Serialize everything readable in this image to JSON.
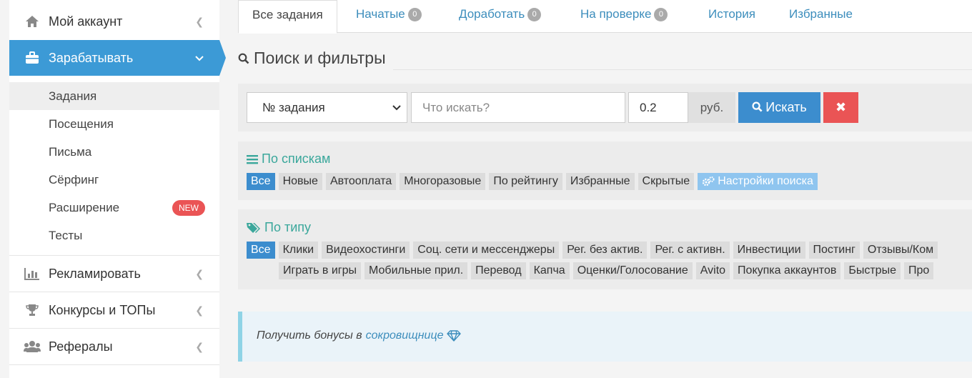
{
  "sidebar": {
    "account": {
      "label": "Мой аккаунт",
      "icon": "home-icon"
    },
    "earn": {
      "label": "Зарабатывать",
      "icon": "briefcase-icon"
    },
    "sub_items": [
      "Задания",
      "Посещения",
      "Письма",
      "Сёрфинг",
      "Расширение",
      "Тесты"
    ],
    "badge_new": "NEW",
    "advertise": {
      "label": "Рекламировать",
      "icon": "bar-chart-icon"
    },
    "contests": {
      "label": "Конкурсы и ТОПы",
      "icon": "trophy-icon"
    },
    "referrals": {
      "label": "Рефералы",
      "icon": "users-icon"
    }
  },
  "tabs": [
    {
      "label": "Все задания"
    },
    {
      "label": "Начатые",
      "count": "0"
    },
    {
      "label": "Доработать",
      "count": "0"
    },
    {
      "label": "На проверке",
      "count": "0"
    },
    {
      "label": "История"
    },
    {
      "label": "Избранные"
    }
  ],
  "search": {
    "title": "Поиск и фильтры",
    "select_value": "№ задания",
    "placeholder": "Что искать?",
    "price": "0.2",
    "currency": "руб.",
    "button": "Искать",
    "clear": "✖"
  },
  "lists": {
    "title": "По спискам",
    "items": [
      "Все",
      "Новые",
      "Автооплата",
      "Многоразовые",
      "По рейтингу",
      "Избранные",
      "Скрытые"
    ],
    "settings": "Настройки поиска"
  },
  "types": {
    "title": "По типу",
    "row1": [
      "Все",
      "Клики",
      "Видеохостинги",
      "Соц. сети и мессенджеры",
      "Рег. без актив.",
      "Рег. с активн.",
      "Инвестиции",
      "Постинг",
      "Отзывы/Ком"
    ],
    "row2": [
      "Играть в игры",
      "Мобильные прил.",
      "Перевод",
      "Капча",
      "Оценки/Голосование",
      "Avito",
      "Покупка аккаунтов",
      "Быстрые",
      "Про"
    ]
  },
  "notice": {
    "text": "Получить бонусы в",
    "link": "сокровищнице"
  },
  "colors": {
    "primary": "#3c8dce",
    "danger": "#ea5455",
    "teal": "#3aa79b"
  }
}
